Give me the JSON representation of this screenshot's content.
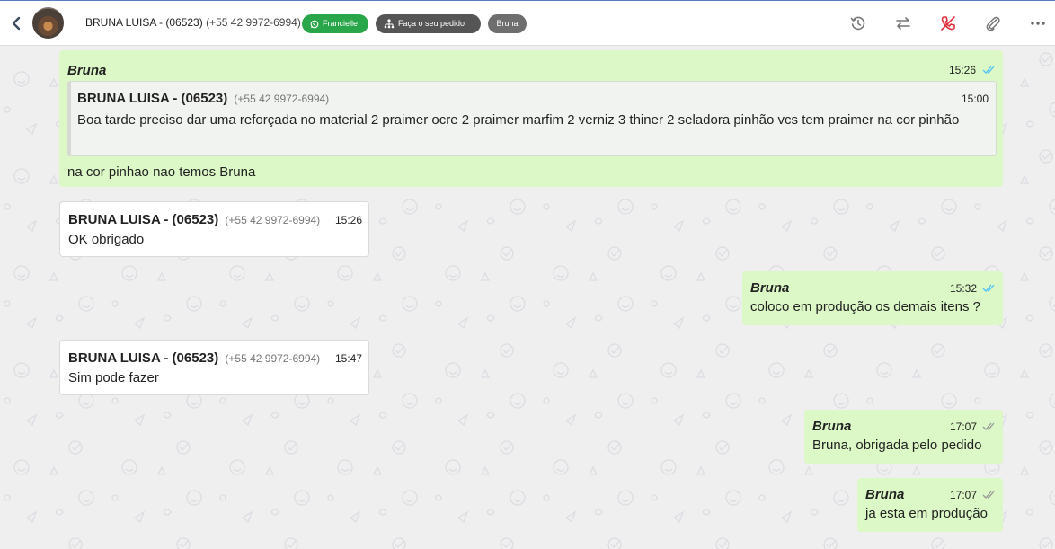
{
  "header": {
    "contact_name": "BRUNA LUISA - (06523)",
    "contact_phone": "(+55 42 9972-6994)",
    "badge_whatsapp": "Francielle",
    "badge_order": "Faça o seu pedido",
    "badge_agent": "Bruna",
    "icons": [
      "back-chevron-icon",
      "history-icon",
      "transfer-icon",
      "hangup-icon",
      "attach-icon",
      "more-icon"
    ]
  },
  "messages": [
    {
      "direction": "outgoing",
      "author": "Bruna",
      "time": "15:26",
      "status": "read",
      "quote": {
        "author": "BRUNA LUISA - (06523)",
        "phone": "(+55 42 9972-6994)",
        "time": "15:00",
        "text": "Boa tarde preciso dar uma reforçada no material 2 praimer ocre 2 praimer marfim 2 verniz 3 thiner 2 seladora pinhão vcs tem praimer na cor pinhão"
      },
      "text": "na cor pinhao nao temos Bruna"
    },
    {
      "direction": "incoming",
      "author": "BRUNA LUISA - (06523)",
      "phone": "(+55 42 9972-6994)",
      "time": "15:26",
      "text": "OK obrigado"
    },
    {
      "direction": "outgoing",
      "author": "Bruna",
      "time": "15:32",
      "status": "read",
      "text": "coloco em produção os demais itens ?"
    },
    {
      "direction": "incoming",
      "author": "BRUNA LUISA - (06523)",
      "phone": "(+55 42 9972-6994)",
      "time": "15:47",
      "text": "Sim pode fazer"
    },
    {
      "direction": "outgoing",
      "author": "Bruna",
      "time": "17:07",
      "status": "delivered",
      "text": "Bruna, obrigada pelo pedido"
    },
    {
      "direction": "outgoing",
      "author": "Bruna",
      "time": "17:07",
      "status": "delivered",
      "text": "ja esta em produção"
    }
  ],
  "colors": {
    "outgoing_bubble": "#dcf8c6",
    "incoming_bubble": "#ffffff",
    "read_ticks": "#4fc3f7",
    "delivered_ticks": "#999999",
    "whatsapp_badge": "#2aa64a",
    "hangup_icon": "#e0323c"
  }
}
